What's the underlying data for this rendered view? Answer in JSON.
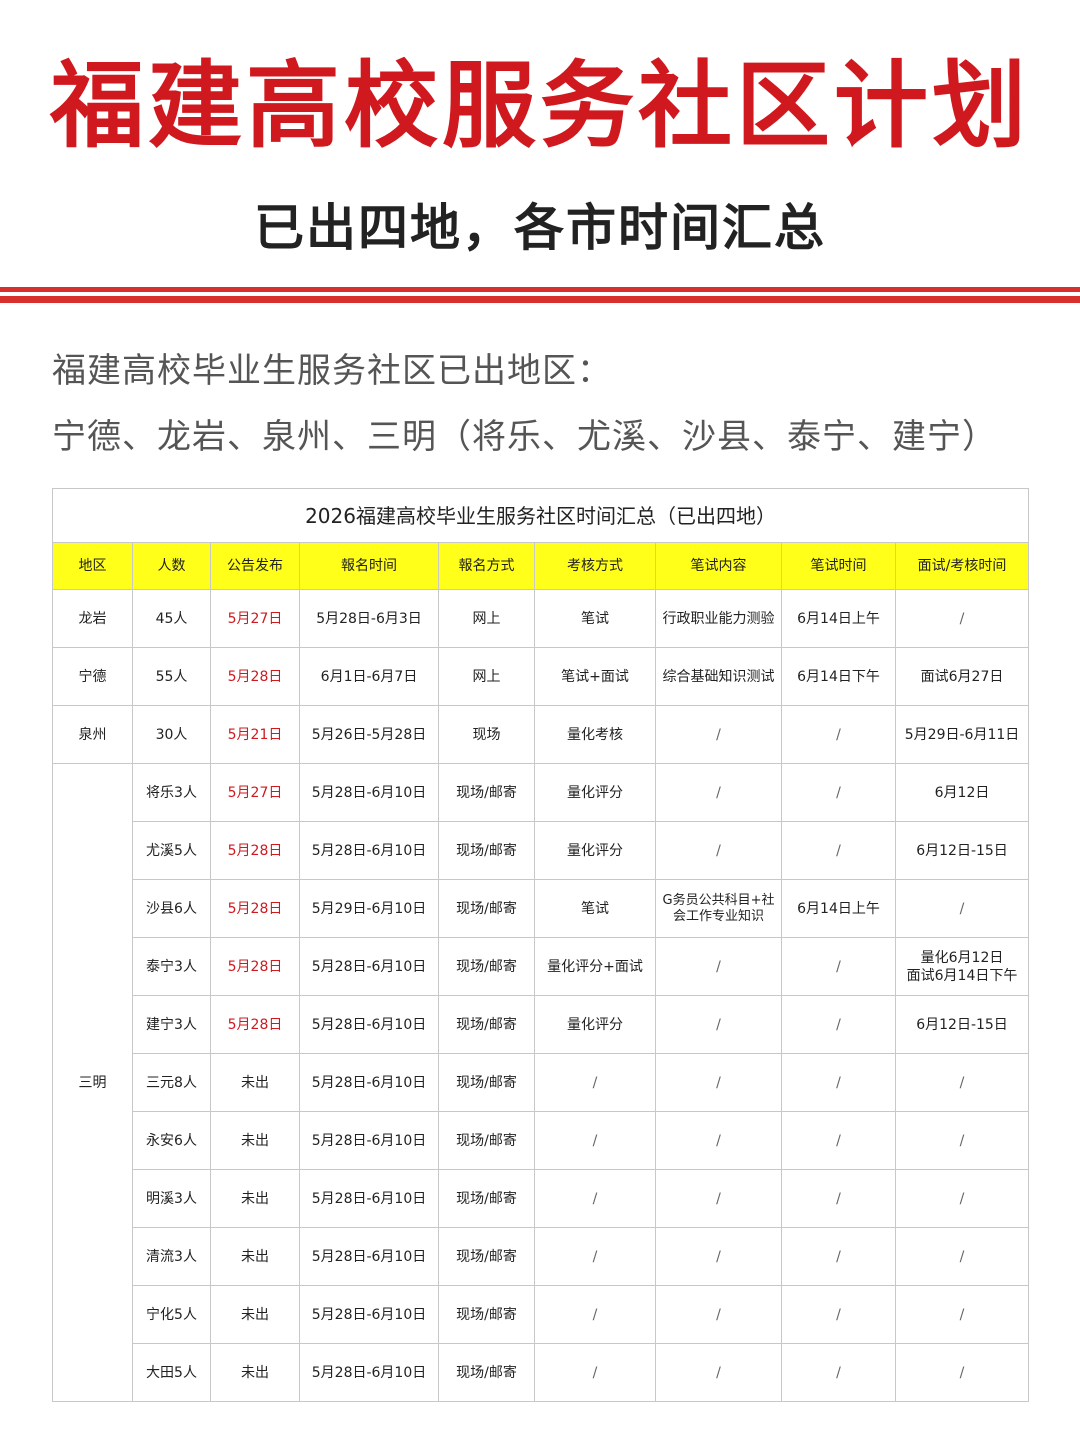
{
  "header": {
    "title": "福建高校服务社区计划",
    "subtitle": "已出四地，各市时间汇总"
  },
  "intro": {
    "line1": "福建高校毕业生服务社区已出地区：",
    "line2": "宁德、龙岩、泉州、三明（将乐、尤溪、沙县、泰宁、建宁）"
  },
  "table": {
    "caption": "2026福建高校毕业生服务社区时间汇总（已出四地）",
    "columns": [
      "地区",
      "人数",
      "公告发布",
      "報名时间",
      "報名方式",
      "考核方式",
      "笔试内容",
      "笔试时间",
      "面试/考核时间"
    ],
    "rows": [
      {
        "region": "龙岩",
        "count": "45人",
        "announce": "5月27日",
        "signup_time": "5月28日-6月3日",
        "signup_method": "网上",
        "assess": "笔试",
        "exam_content": "行政职业能力测验",
        "exam_time": "6月14日上午",
        "interview": "/"
      },
      {
        "region": "宁德",
        "count": "55人",
        "announce": "5月28日",
        "signup_time": "6月1日-6月7日",
        "signup_method": "网上",
        "assess": "笔试+面试",
        "exam_content": "综合基础知识测试",
        "exam_time": "6月14日下午",
        "interview": "面试6月27日"
      },
      {
        "region": "泉州",
        "count": "30人",
        "announce": "5月21日",
        "signup_time": "5月26日-5月28日",
        "signup_method": "现场",
        "assess": "量化考核",
        "exam_content": "/",
        "exam_time": "/",
        "interview": "5月29日-6月11日"
      }
    ],
    "sanming": {
      "region": "三明",
      "rows": [
        {
          "count": "将乐3人",
          "announce": "5月27日",
          "signup_time": "5月28日-6月10日",
          "signup_method": "现场/邮寄",
          "assess": "量化评分",
          "exam_content": "/",
          "exam_time": "/",
          "interview": "6月12日"
        },
        {
          "count": "尤溪5人",
          "announce": "5月28日",
          "signup_time": "5月28日-6月10日",
          "signup_method": "现场/邮寄",
          "assess": "量化评分",
          "exam_content": "/",
          "exam_time": "/",
          "interview": "6月12日-15日"
        },
        {
          "count": "沙县6人",
          "announce": "5月28日",
          "signup_time": "5月29日-6月10日",
          "signup_method": "现场/邮寄",
          "assess": "笔试",
          "exam_content": "G务员公共科目+社会工作专业知识",
          "exam_time": "6月14日上午",
          "interview": "/"
        },
        {
          "count": "泰宁3人",
          "announce": "5月28日",
          "signup_time": "5月28日-6月10日",
          "signup_method": "现场/邮寄",
          "assess": "量化评分+面试",
          "exam_content": "/",
          "exam_time": "/",
          "interview": "量化6月12日\n面试6月14日下午"
        },
        {
          "count": "建宁3人",
          "announce": "5月28日",
          "signup_time": "5月28日-6月10日",
          "signup_method": "现场/邮寄",
          "assess": "量化评分",
          "exam_content": "/",
          "exam_time": "/",
          "interview": "6月12日-15日"
        },
        {
          "count": "三元8人",
          "announce": "未出",
          "signup_time": "5月28日-6月10日",
          "signup_method": "现场/邮寄",
          "assess": "/",
          "exam_content": "/",
          "exam_time": "/",
          "interview": "/"
        },
        {
          "count": "永安6人",
          "announce": "未出",
          "signup_time": "5月28日-6月10日",
          "signup_method": "现场/邮寄",
          "assess": "/",
          "exam_content": "/",
          "exam_time": "/",
          "interview": "/"
        },
        {
          "count": "明溪3人",
          "announce": "未出",
          "signup_time": "5月28日-6月10日",
          "signup_method": "现场/邮寄",
          "assess": "/",
          "exam_content": "/",
          "exam_time": "/",
          "interview": "/"
        },
        {
          "count": "清流3人",
          "announce": "未出",
          "signup_time": "5月28日-6月10日",
          "signup_method": "现场/邮寄",
          "assess": "/",
          "exam_content": "/",
          "exam_time": "/",
          "interview": "/"
        },
        {
          "count": "宁化5人",
          "announce": "未出",
          "signup_time": "5月28日-6月10日",
          "signup_method": "现场/邮寄",
          "assess": "/",
          "exam_content": "/",
          "exam_time": "/",
          "interview": "/"
        },
        {
          "count": "大田5人",
          "announce": "未出",
          "signup_time": "5月28日-6月10日",
          "signup_method": "现场/邮寄",
          "assess": "/",
          "exam_content": "/",
          "exam_time": "/",
          "interview": "/"
        }
      ]
    },
    "colors": {
      "title_red": "#d0191f",
      "header_yellow": "#ffff1a",
      "stripe_red": "#d8302c"
    }
  }
}
